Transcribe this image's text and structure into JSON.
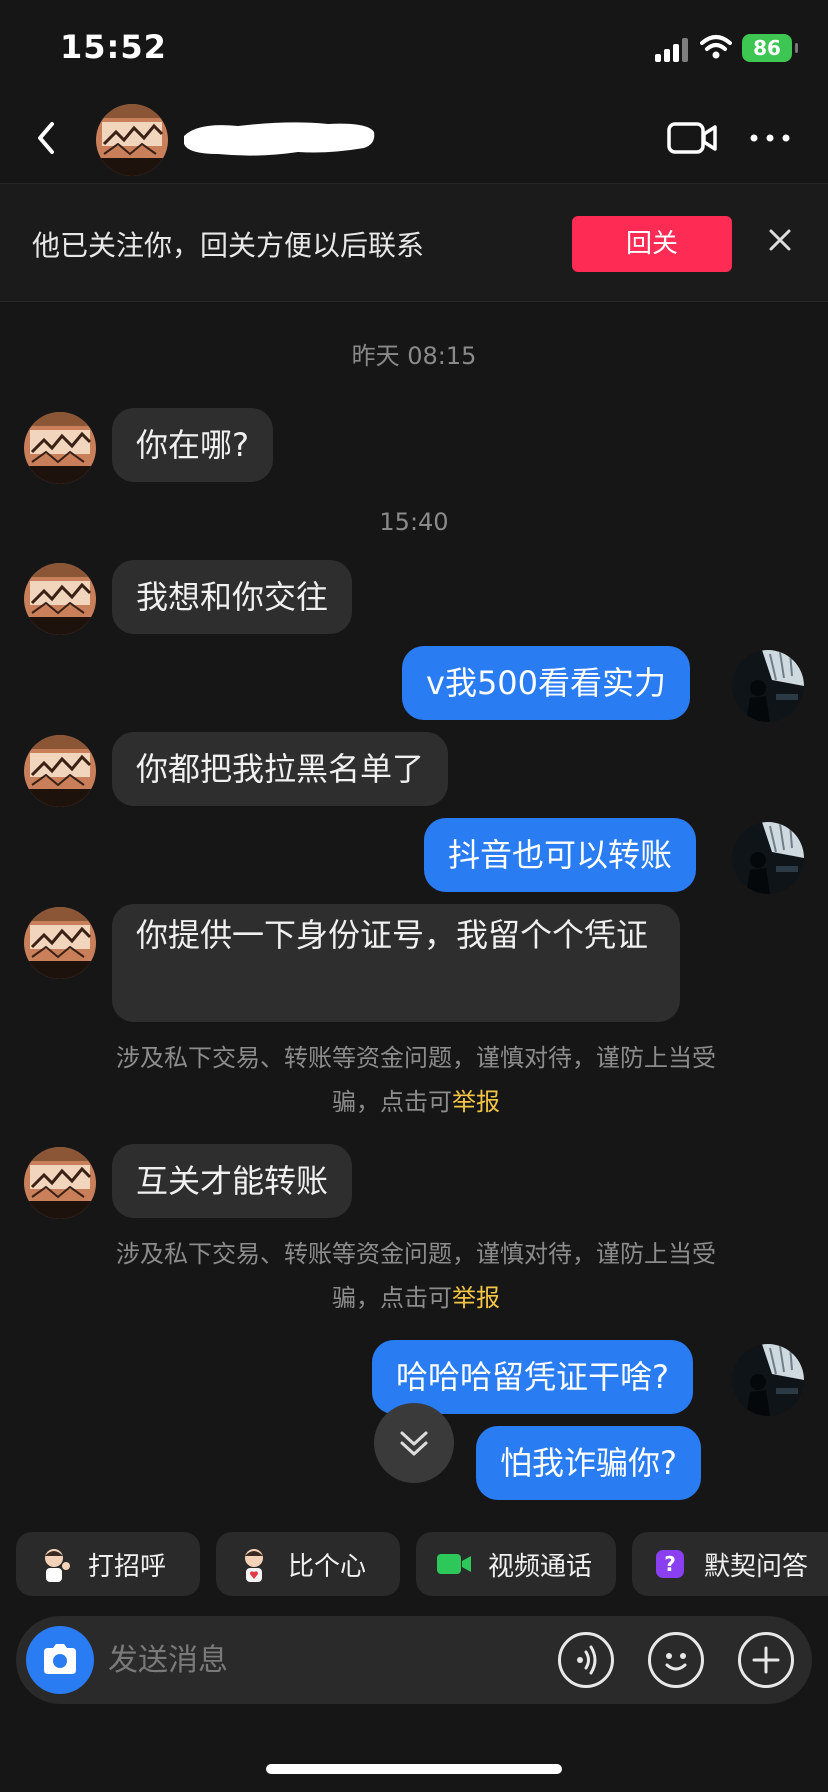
{
  "status_bar": {
    "time": "15:52",
    "battery": "86"
  },
  "header": {
    "contact_name": ""
  },
  "follow_bar": {
    "text": "他已关注你，回关方便以后联系",
    "button": "回关"
  },
  "timestamps": [
    "昨天 08:15",
    "15:40"
  ],
  "messages": [
    {
      "side": "left",
      "text": "你在哪?"
    },
    {
      "side": "left",
      "text": "我想和你交往"
    },
    {
      "side": "right",
      "text": "v我500看看实力"
    },
    {
      "side": "left",
      "text": "你都把我拉黑名单了"
    },
    {
      "side": "right",
      "text": "抖音也可以转账"
    },
    {
      "side": "left",
      "text": "你提供一下身份证号，我留个个凭证"
    },
    {
      "side": "left",
      "text": "互关才能转账"
    },
    {
      "side": "right",
      "text": "哈哈哈留凭证干啥?"
    },
    {
      "side": "right",
      "text": "怕我诈骗你?"
    }
  ],
  "warning": {
    "line1": "涉及私下交易、转账等资金问题，谨慎对待，谨防上当受",
    "line2_prefix": "骗，点击可",
    "link": "举报"
  },
  "quick_replies": [
    {
      "label": "打招呼",
      "icon": "wave-avatar-icon"
    },
    {
      "label": "比个心",
      "icon": "heart-avatar-icon"
    },
    {
      "label": "视频通话",
      "icon": "video-call-icon"
    },
    {
      "label": "默契问答",
      "icon": "question-icon"
    }
  ],
  "input": {
    "placeholder": "发送消息"
  },
  "colors": {
    "background": "#161616",
    "bubble_left": "#2e2e2e",
    "bubble_right": "#2a7cf3",
    "follow_button": "#fe2c55",
    "report_link": "#f5c544",
    "battery": "#3ec653"
  }
}
